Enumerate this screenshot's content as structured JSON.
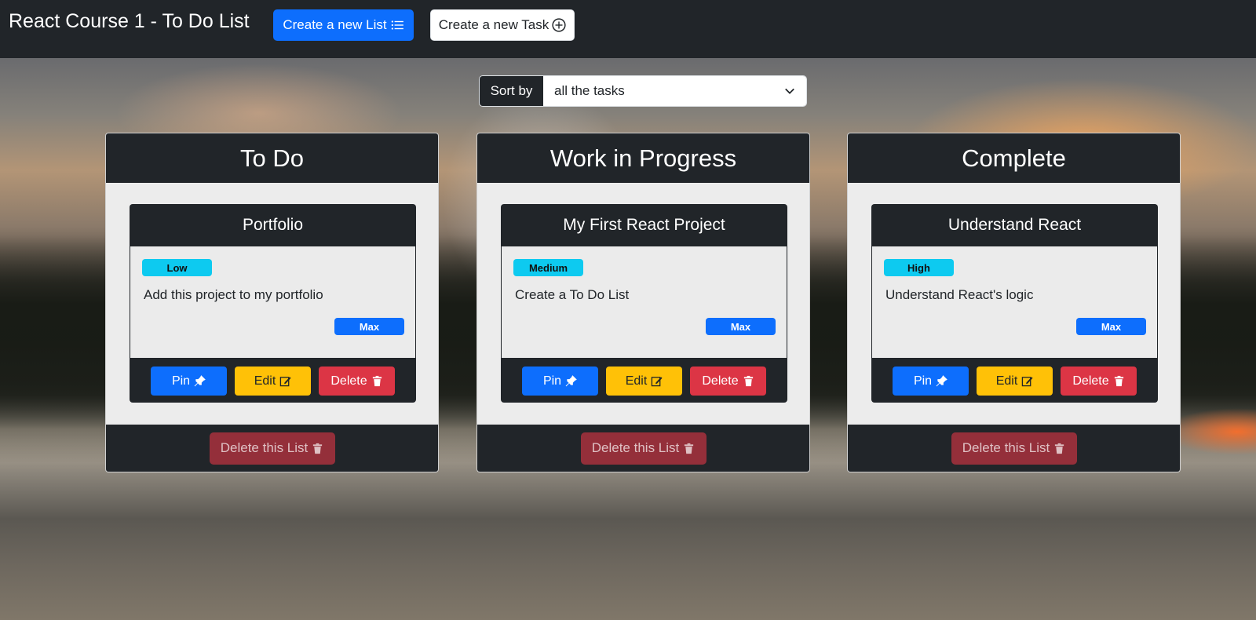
{
  "navbar": {
    "brand": "React Course 1 - To Do List",
    "create_list_label": "Create a new List",
    "create_task_label": "Create a new Task"
  },
  "sort": {
    "label": "Sort by",
    "selected": "all the tasks"
  },
  "lists": [
    {
      "title": "To Do",
      "tasks": [
        {
          "title": "Portfolio",
          "priority": "Low",
          "description": "Add this project to my portfolio",
          "owner": "Max",
          "pin_label": "Pin",
          "edit_label": "Edit",
          "delete_label": "Delete"
        }
      ],
      "delete_list_label": "Delete this List"
    },
    {
      "title": "Work in Progress",
      "tasks": [
        {
          "title": "My First React Project",
          "priority": "Medium",
          "description": "Create a To Do List",
          "owner": "Max",
          "pin_label": "Pin",
          "edit_label": "Edit",
          "delete_label": "Delete"
        }
      ],
      "delete_list_label": "Delete this List"
    },
    {
      "title": "Complete",
      "tasks": [
        {
          "title": "Understand React",
          "priority": "High",
          "description": "Understand React's logic",
          "owner": "Max",
          "pin_label": "Pin",
          "edit_label": "Edit",
          "delete_label": "Delete"
        }
      ],
      "delete_list_label": "Delete this List"
    }
  ],
  "colors": {
    "navbar": "#212529",
    "primary": "#0d6efd",
    "info": "#0dcaf0",
    "warning": "#ffc107",
    "danger": "#dc3545"
  },
  "icons": {
    "list": "list-icon",
    "add": "plus-circle-icon",
    "chevron": "chevron-down-icon",
    "pin": "pin-icon",
    "edit": "edit-icon",
    "trash": "trash-icon"
  }
}
